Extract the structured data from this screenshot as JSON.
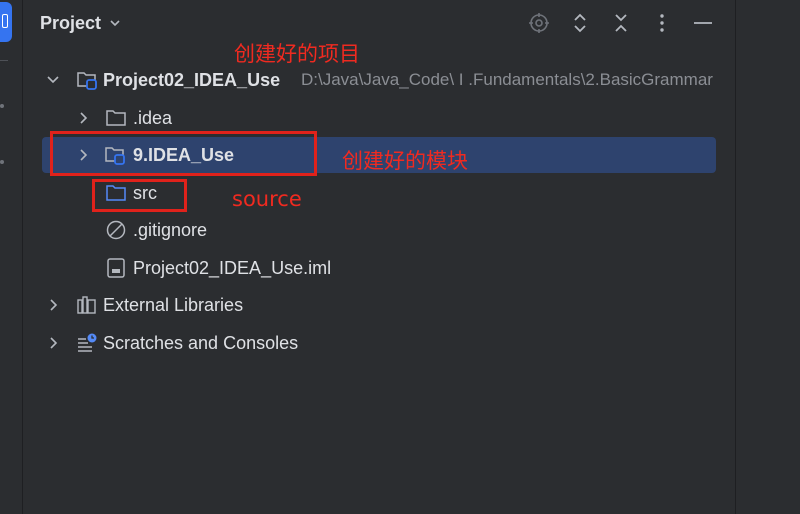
{
  "panel": {
    "title": "Project"
  },
  "tree": {
    "root": {
      "name": "Project02_IDEA_Use",
      "path": "D:\\Java\\Java_Code\\ I .Fundamentals\\2.BasicGrammar"
    },
    "idea": {
      "name": ".idea"
    },
    "module": {
      "name": "9.IDEA_Use"
    },
    "src": {
      "name": "src"
    },
    "gitignore": {
      "name": ".gitignore"
    },
    "iml": {
      "name": "Project02_IDEA_Use.iml"
    },
    "external": {
      "name": "External Libraries"
    },
    "scratches": {
      "name": "Scratches and Consoles"
    }
  },
  "annotations": {
    "project": "创建好的项目",
    "module": "创建好的模块",
    "source": "source"
  },
  "colors": {
    "background": "#2b2d30",
    "selection": "#2e436e",
    "accent": "#3574f0",
    "annotation": "#e0221b"
  },
  "icons": {
    "header": [
      "locate-icon",
      "expand-icon",
      "collapse-icon",
      "more-icon",
      "hide-icon"
    ]
  }
}
